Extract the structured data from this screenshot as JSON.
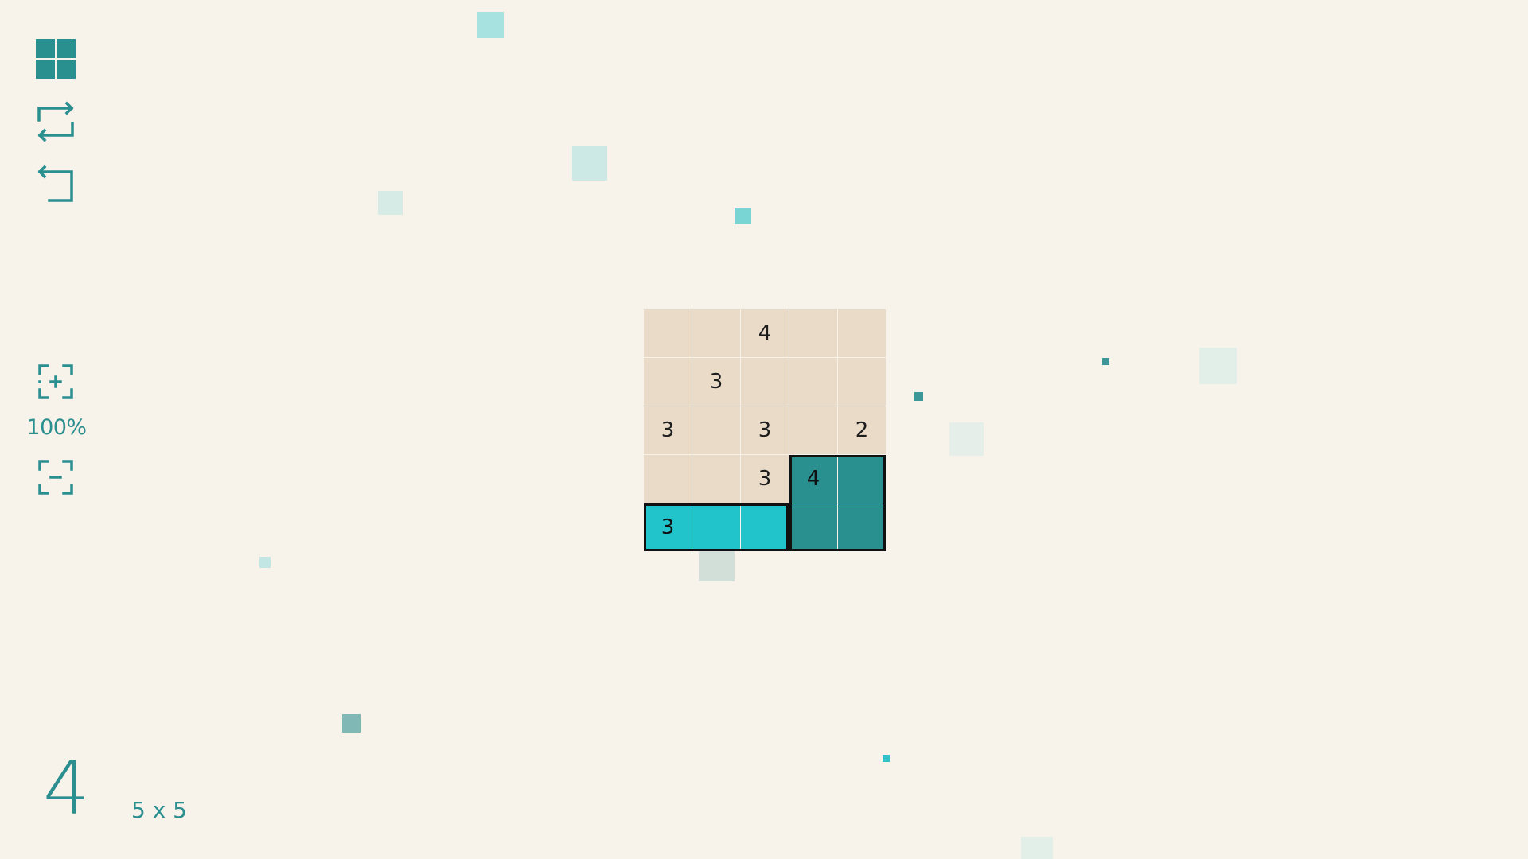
{
  "sidebar": {
    "levels_icon": "grid-icon",
    "restart_icon": "restart-icon",
    "undo_icon": "undo-icon",
    "zoom_in_icon": "zoom-in-icon",
    "zoom_level": "100%",
    "zoom_out_icon": "zoom-out-icon"
  },
  "level": {
    "number": "4",
    "size": "5 x 5"
  },
  "board": {
    "rows": 5,
    "cols": 5,
    "cells": [
      [
        "",
        "",
        "4",
        "",
        ""
      ],
      [
        "",
        "3",
        "",
        "",
        ""
      ],
      [
        "3",
        "",
        "3",
        "",
        "2"
      ],
      [
        "",
        "",
        "3",
        "4",
        ""
      ],
      [
        "3",
        "",
        "",
        "",
        ""
      ]
    ],
    "fills": [
      [
        "",
        "",
        "",
        "",
        ""
      ],
      [
        "",
        "",
        "",
        "",
        ""
      ],
      [
        "",
        "",
        "",
        "",
        ""
      ],
      [
        "",
        "",
        "",
        "teal",
        "teal"
      ],
      [
        "cyan",
        "cyan",
        "cyan",
        "teal",
        "teal"
      ]
    ]
  },
  "colors": {
    "background": "#f7f2ea",
    "empty_cell": "#e9dbc8",
    "teal": "#2a8f8f",
    "cyan": "#22c4cb",
    "accent": "#2b8f8f"
  }
}
